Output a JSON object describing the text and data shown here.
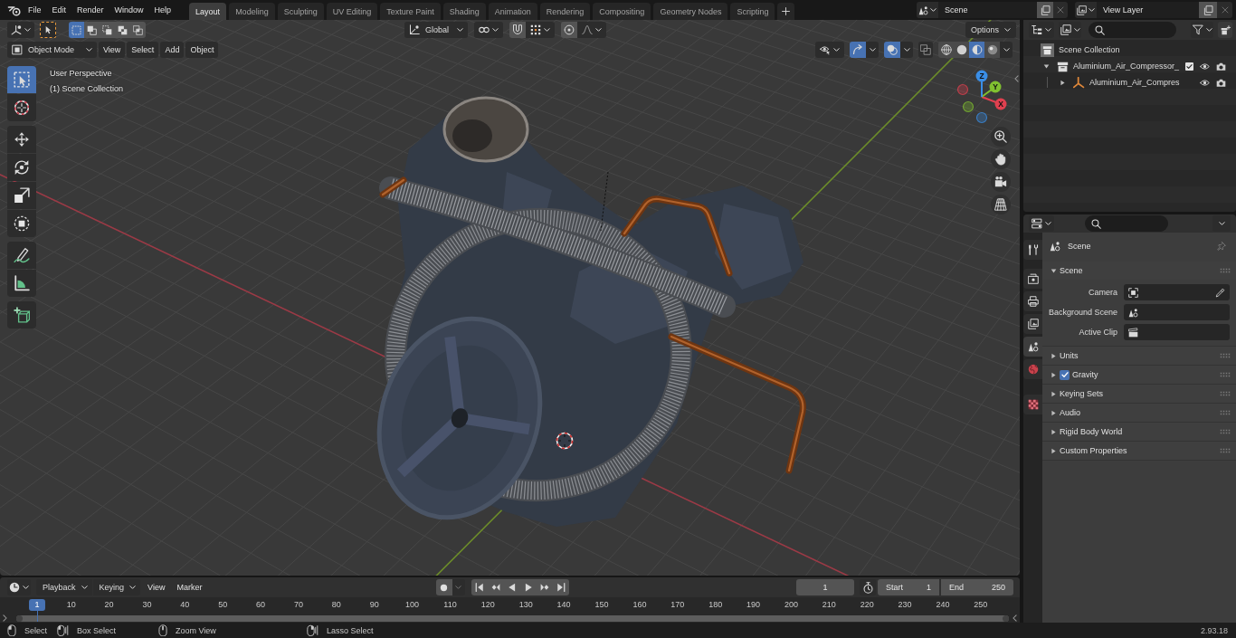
{
  "top_bar": {
    "menus": [
      "File",
      "Edit",
      "Render",
      "Window",
      "Help"
    ],
    "workspaces": [
      {
        "label": "Layout",
        "selected": true
      },
      {
        "label": "Modeling",
        "selected": false
      },
      {
        "label": "Sculpting",
        "selected": false
      },
      {
        "label": "UV Editing",
        "selected": false
      },
      {
        "label": "Texture Paint",
        "selected": false
      },
      {
        "label": "Shading",
        "selected": false
      },
      {
        "label": "Animation",
        "selected": false
      },
      {
        "label": "Rendering",
        "selected": false
      },
      {
        "label": "Compositing",
        "selected": false
      },
      {
        "label": "Geometry Nodes",
        "selected": false
      },
      {
        "label": "Scripting",
        "selected": false
      }
    ],
    "scene": "Scene",
    "view_layer": "View Layer"
  },
  "tool_header": {
    "select_modes": [
      {
        "kind": "set",
        "selected": true
      },
      {
        "kind": "extend",
        "selected": false
      },
      {
        "kind": "subtract",
        "selected": false
      },
      {
        "kind": "invert",
        "selected": false
      },
      {
        "kind": "intersect",
        "selected": false
      }
    ],
    "orientation": "Global",
    "options": "Options"
  },
  "viewport_header": {
    "mode": "Object Mode",
    "menus": [
      "View",
      "Select",
      "Add",
      "Object"
    ],
    "gizmos": true,
    "overlays": true,
    "xray": false,
    "shading": [
      {
        "kind": "wireframe",
        "selected": false
      },
      {
        "kind": "solid",
        "selected": false
      },
      {
        "kind": "material",
        "selected": true
      },
      {
        "kind": "rendered",
        "selected": false
      }
    ]
  },
  "viewport": {
    "view_name": "User Perspective",
    "collection": "(1) Scene Collection",
    "tool_groups": [
      [
        {
          "kind": "select",
          "selected": true
        },
        {
          "kind": "cursor",
          "selected": false
        }
      ],
      [
        {
          "kind": "move",
          "selected": false
        },
        {
          "kind": "rotate",
          "selected": false
        },
        {
          "kind": "scale",
          "selected": false
        },
        {
          "kind": "transform",
          "selected": false
        }
      ],
      [
        {
          "kind": "annotate",
          "selected": false
        },
        {
          "kind": "measure",
          "selected": false
        }
      ],
      [
        {
          "kind": "add",
          "selected": false
        }
      ]
    ],
    "nav_gizmo": [
      {
        "label": "X",
        "color": "#e0404f"
      },
      {
        "label": "Y",
        "color": "#80c030"
      },
      {
        "label": "Z",
        "color": "#3a8ee6"
      }
    ]
  },
  "timeline": {
    "dropdowns": [
      "Playback",
      "Keying"
    ],
    "menus": [
      "View",
      "Marker"
    ],
    "current_frame": "1",
    "start": {
      "label": "Start",
      "value": "1"
    },
    "end": {
      "label": "End",
      "value": "250"
    },
    "frames": [
      {
        "label": "1",
        "selected": true
      },
      {
        "label": "10",
        "selected": false
      },
      {
        "label": "20",
        "selected": false
      },
      {
        "label": "30",
        "selected": false
      },
      {
        "label": "40",
        "selected": false
      },
      {
        "label": "50",
        "selected": false
      },
      {
        "label": "60",
        "selected": false
      },
      {
        "label": "70",
        "selected": false
      },
      {
        "label": "80",
        "selected": false
      },
      {
        "label": "90",
        "selected": false
      },
      {
        "label": "100",
        "selected": false
      },
      {
        "label": "110",
        "selected": false
      },
      {
        "label": "120",
        "selected": false
      },
      {
        "label": "130",
        "selected": false
      },
      {
        "label": "140",
        "selected": false
      },
      {
        "label": "150",
        "selected": false
      },
      {
        "label": "160",
        "selected": false
      },
      {
        "label": "170",
        "selected": false
      },
      {
        "label": "180",
        "selected": false
      },
      {
        "label": "190",
        "selected": false
      },
      {
        "label": "200",
        "selected": false
      },
      {
        "label": "210",
        "selected": false
      },
      {
        "label": "220",
        "selected": false
      },
      {
        "label": "230",
        "selected": false
      },
      {
        "label": "240",
        "selected": false
      },
      {
        "label": "250",
        "selected": false
      }
    ]
  },
  "outliner": {
    "tree": {
      "kind": "scene_collection",
      "label": "Scene Collection",
      "children": [
        {
          "kind": "collection",
          "label": "Aluminium_Air_Compressor_",
          "expanded": true,
          "checked": true,
          "visible": true,
          "renderable": true,
          "children": [
            {
              "kind": "object",
              "label": "Aluminium_Air_Compres",
              "expanded": false,
              "visible": true,
              "renderable": true
            }
          ]
        }
      ]
    }
  },
  "properties": {
    "tab_groups": [
      [
        {
          "kind": "tool",
          "selected": false
        }
      ],
      [
        {
          "kind": "render",
          "selected": false
        },
        {
          "kind": "output",
          "selected": false
        },
        {
          "kind": "view_layer",
          "selected": false
        },
        {
          "kind": "scene",
          "selected": true
        },
        {
          "kind": "world",
          "selected": false
        }
      ],
      [
        {
          "kind": "texture",
          "selected": false
        }
      ]
    ],
    "context": "Scene",
    "panels": [
      {
        "label": "Scene",
        "expanded": true,
        "fields": [
          {
            "kind": "camera",
            "label": "Camera"
          },
          {
            "kind": "scene",
            "label": "Background Scene"
          },
          {
            "kind": "clip",
            "label": "Active Clip"
          }
        ]
      },
      {
        "label": "Units",
        "expanded": false
      },
      {
        "label": "Gravity",
        "expanded": false,
        "toggle": {
          "checked": true
        }
      },
      {
        "label": "Keying Sets",
        "expanded": false
      },
      {
        "label": "Audio",
        "expanded": false
      },
      {
        "label": "Rigid Body World",
        "expanded": false
      },
      {
        "label": "Custom Properties",
        "expanded": false
      }
    ]
  },
  "status_bar": {
    "hints": [
      {
        "kind": "click",
        "label": "Select"
      },
      {
        "kind": "drag",
        "label": "Box Select"
      },
      {
        "kind": "middle",
        "label": "Zoom View"
      },
      {
        "kind": "lasso",
        "label": "Lasso Select"
      }
    ],
    "version": "2.93.18"
  }
}
